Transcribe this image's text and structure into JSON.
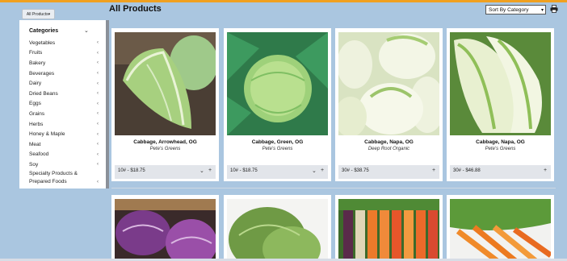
{
  "header": {
    "breadcrumb_pill": "All Products▾",
    "title": "All Products",
    "sort_label": "Sort By Category",
    "print_icon": "print-icon"
  },
  "sidebar": {
    "title": "Categories",
    "items": [
      {
        "label": "Vegetables"
      },
      {
        "label": "Fruits"
      },
      {
        "label": "Bakery"
      },
      {
        "label": "Beverages"
      },
      {
        "label": "Dairy"
      },
      {
        "label": "Dried Beans"
      },
      {
        "label": "Eggs"
      },
      {
        "label": "Grains"
      },
      {
        "label": "Herbs"
      },
      {
        "label": "Honey & Maple"
      },
      {
        "label": "Meat"
      },
      {
        "label": "Seafood"
      },
      {
        "label": "Soy"
      },
      {
        "label_line1": "Specialty Products &",
        "label_line2": "Prepared Foods"
      }
    ]
  },
  "products": [
    {
      "name": "Cabbage, Arrowhead, OG",
      "farm": "Pete's Greens",
      "price": "10# - $18.75",
      "has_dropdown": true
    },
    {
      "name": "Cabbage, Green, OG",
      "farm": "Pete's Greens",
      "price": "10# - $18.75",
      "has_dropdown": true
    },
    {
      "name": "Cabbage, Napa, OG",
      "farm": "Deep Root Organic",
      "price": "30# - $38.75",
      "has_dropdown": false
    },
    {
      "name": "Cabbage, Napa, OG",
      "farm": "Pete's Greens",
      "price": "30# - $46.88",
      "has_dropdown": false
    }
  ],
  "colors": {
    "background": "#aac6e0",
    "accent_topbar": "#f0a020",
    "card": "#ffffff",
    "price_bar": "#e2e5ea"
  }
}
